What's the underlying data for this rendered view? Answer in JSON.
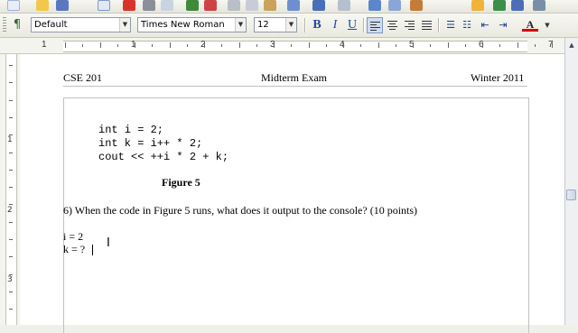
{
  "standard_toolbar": {
    "icons": [
      "new-icon",
      "open-icon",
      "save-icon",
      "edit-file-icon",
      "export-pdf-icon",
      "print-icon",
      "page-preview-icon",
      "spellcheck-icon",
      "autospell-icon",
      "cut-icon",
      "copy-icon",
      "paste-icon",
      "clone-icon",
      "undo-icon",
      "redo-icon",
      "hyperlink-icon",
      "table-icon",
      "show-draw-icon",
      "navigator-icon",
      "gallery-icon",
      "nonprinting-chars-icon",
      "zoom-icon"
    ]
  },
  "formatting_toolbar": {
    "style": "Default",
    "font": "Times New Roman",
    "size": "12",
    "bold_label": "B",
    "italic_label": "I",
    "underline_label": "U",
    "font_color_label": "A"
  },
  "ruler": {
    "numbers": [
      "1",
      "1",
      "2",
      "3",
      "4",
      "5",
      "6",
      "7"
    ]
  },
  "vertical_ruler": {
    "numbers": [
      "1",
      "2",
      "3"
    ]
  },
  "document": {
    "header_left": "CSE 201",
    "header_center": "Midterm Exam",
    "header_right": "Winter 2011",
    "code_lines": [
      "int i = 2;",
      "int k = i++ * 2;",
      "cout << ++i * 2 + k;"
    ],
    "figure_caption": "Figure 5",
    "question": "6) When the code in Figure 5 runs, what does it output to the console?  (10 points)",
    "answer_lines": [
      "i = 2",
      "k = ? "
    ]
  },
  "colors": {
    "toolbar_bg": "#ecece4",
    "active_button": "#cfdcf0",
    "page_bg": "#ffffff",
    "boundary": "#c0c0c0"
  }
}
